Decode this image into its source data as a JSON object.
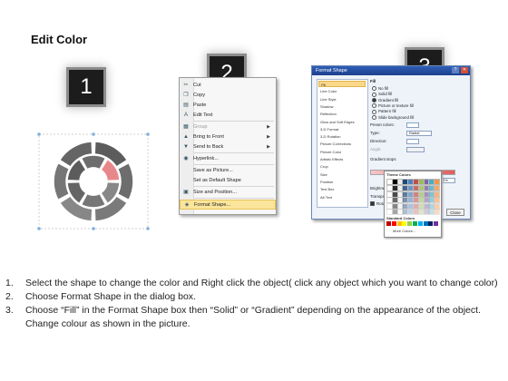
{
  "title": "Edit Color",
  "steps": [
    {
      "num": "1",
      "label": "1."
    },
    {
      "num": "2",
      "label": "2"
    },
    {
      "num": "3",
      "label": "3"
    }
  ],
  "context_menu": {
    "items": [
      {
        "label": "Cut",
        "icon": "scissors-icon",
        "glyph": "✂"
      },
      {
        "label": "Copy",
        "icon": "copy-icon",
        "glyph": "❐"
      },
      {
        "label": "Paste",
        "icon": "paste-icon",
        "glyph": "▤"
      },
      {
        "label": "Edit Text",
        "icon": "edit-text-icon",
        "glyph": "A"
      },
      {
        "label": "Group",
        "icon": "group-icon",
        "glyph": "▦",
        "disabled": true,
        "submenu": true
      },
      {
        "label": "Bring to Front",
        "icon": "bring-front-icon",
        "glyph": "▲",
        "submenu": true
      },
      {
        "label": "Send to Back",
        "icon": "send-back-icon",
        "glyph": "▼",
        "submenu": true
      },
      {
        "label": "Hyperlink...",
        "icon": "hyperlink-icon",
        "glyph": "◉"
      },
      {
        "label": "Save as Picture...",
        "icon": "",
        "glyph": ""
      },
      {
        "label": "Set as Default Shape",
        "icon": "",
        "glyph": ""
      },
      {
        "label": "Size and Position...",
        "icon": "size-icon",
        "glyph": "▣"
      },
      {
        "label": "Format Shape...",
        "icon": "format-shape-icon",
        "glyph": "◈",
        "highlight": true
      }
    ]
  },
  "format_dialog": {
    "title": "Format Shape",
    "nav": [
      "Fill",
      "Line Color",
      "Line Style",
      "Shadow",
      "Reflection",
      "Glow and Soft Edges",
      "3-D Format",
      "3-D Rotation",
      "Picture Corrections",
      "Picture Color",
      "Artistic Effects",
      "Crop",
      "Size",
      "Position",
      "Text Box",
      "Alt Text"
    ],
    "fill_heading": "Fill",
    "fill_options": [
      {
        "label": "No fill",
        "on": false
      },
      {
        "label": "Solid fill",
        "on": false
      },
      {
        "label": "Gradient fill",
        "on": true
      },
      {
        "label": "Picture or texture fill",
        "on": false
      },
      {
        "label": "Pattern fill",
        "on": false
      },
      {
        "label": "Slide background fill",
        "on": false
      }
    ],
    "fields": [
      "Preset colors:",
      "Type:",
      "Direction:",
      "Angle:",
      "Gradient stops"
    ],
    "type_value": "Radial",
    "position_label": "Position:",
    "position_value": "0%",
    "brightness_label": "Brightness:",
    "transparency_label": "Transparency:",
    "rotate_label": "Rotate with shape",
    "close_label": "Close",
    "palette": {
      "theme_heading": "Theme Colors",
      "standard_heading": "Standard Colors",
      "more": "More Colors...",
      "theme_row": [
        "#ffffff",
        "#000000",
        "#eeece1",
        "#1f497d",
        "#4f81bd",
        "#c0504d",
        "#9bbb59",
        "#8064a2",
        "#4bacc6",
        "#f79646"
      ],
      "standard_row": [
        "#c00000",
        "#ff0000",
        "#ffc000",
        "#ffff00",
        "#92d050",
        "#00b050",
        "#00b0f0",
        "#0070c0",
        "#002060",
        "#7030a0"
      ]
    }
  },
  "ring": {
    "segment_color": "#6e6e6e",
    "highlight_color": "#e8878a"
  },
  "instructions": [
    {
      "num": "1.",
      "text": "Select the shape to change the color and Right click the object( click any object which you want to change color)"
    },
    {
      "num": "2.",
      "text": "Choose Format Shape in the dialog box."
    },
    {
      "num": "3.",
      "text": "Choose “Fill” in the Format Shape box then “Solid” or “Gradient” depending on the appearance of the object. Change colour as shown in the picture."
    }
  ]
}
